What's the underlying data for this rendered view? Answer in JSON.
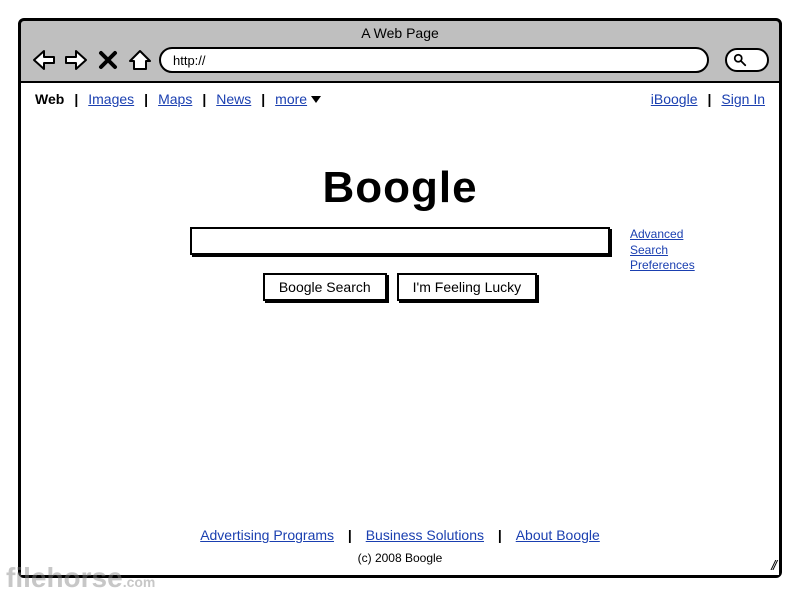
{
  "window": {
    "title": "A Web Page",
    "url": "http://"
  },
  "nav": {
    "left": [
      {
        "label": "Web",
        "active": true
      },
      {
        "label": "Images"
      },
      {
        "label": "Maps"
      },
      {
        "label": "News"
      },
      {
        "label": "more",
        "dropdown": true
      }
    ],
    "right": [
      {
        "label": "iBoogle"
      },
      {
        "label": "Sign In"
      }
    ]
  },
  "main": {
    "logo": "Boogle",
    "search_value": "",
    "buttons": {
      "search": "Boogle Search",
      "lucky": "I'm Feeling Lucky"
    },
    "side_links": {
      "advanced": "Advanced Search",
      "preferences": "Preferences"
    }
  },
  "footer": {
    "links": [
      "Advertising Programs",
      "Business Solutions",
      "About Boogle"
    ],
    "copyright": "(c) 2008 Boogle"
  },
  "watermark": {
    "main": "filehorse",
    "suffix": ".com"
  }
}
